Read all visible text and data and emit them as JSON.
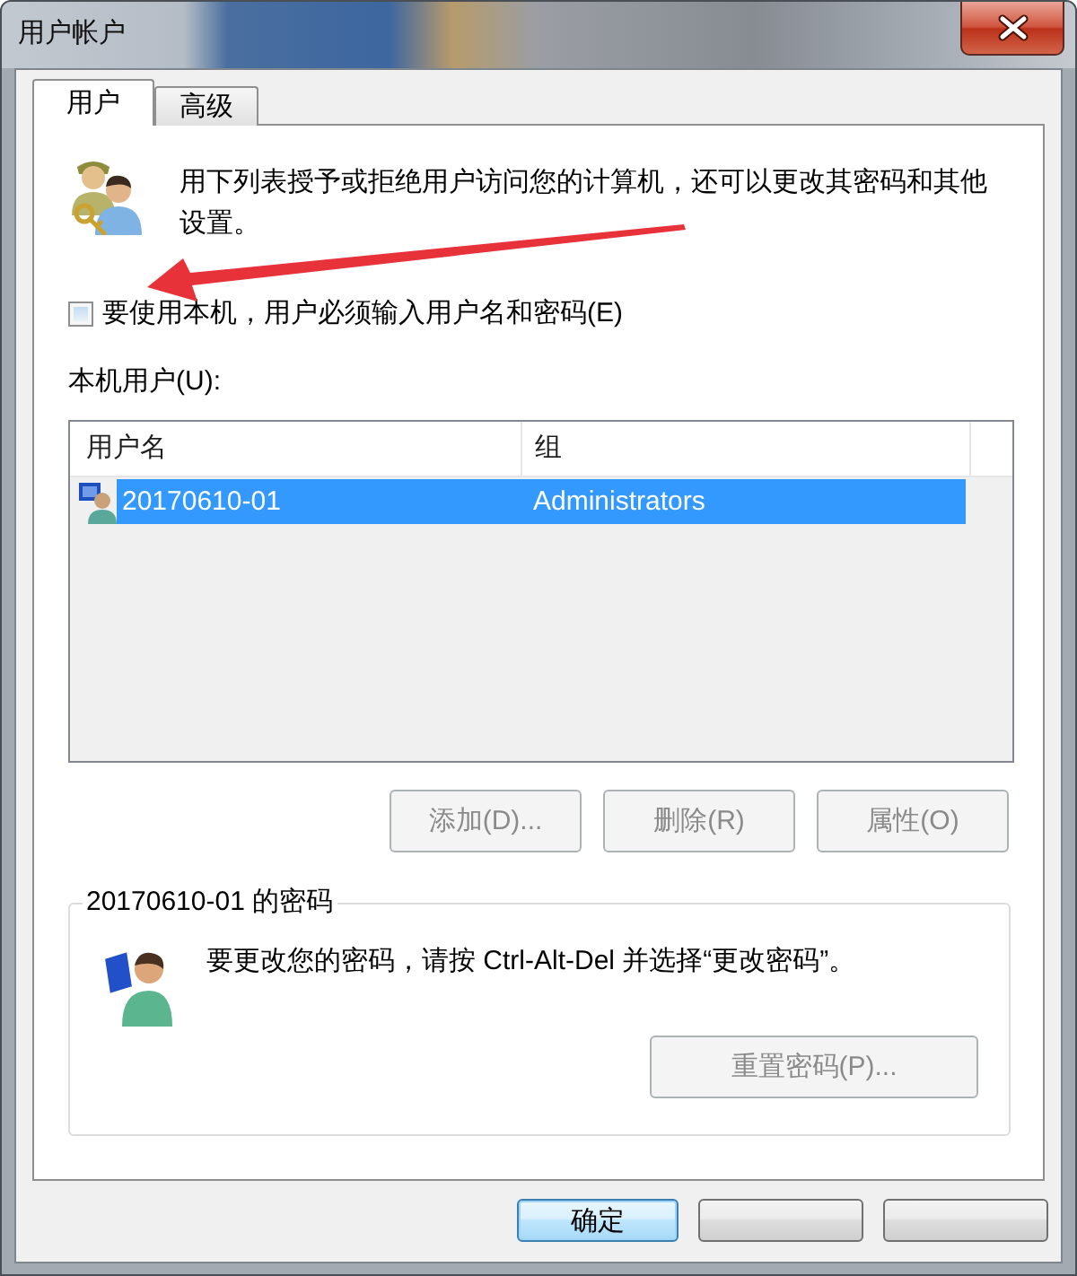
{
  "window": {
    "title": "用户帐户"
  },
  "tabs": [
    {
      "label": "用户",
      "selected": true
    },
    {
      "label": "高级",
      "selected": false
    }
  ],
  "intro": {
    "text": "用下列表授予或拒绝用户访问您的计算机，还可以更改其密码和其他设置。"
  },
  "checkbox": {
    "label": "要使用本机，用户必须输入用户名和密码(E)",
    "checked": false
  },
  "user_list": {
    "label": "本机用户(U):",
    "disabled": true,
    "columns": [
      "用户名",
      "组"
    ],
    "rows": [
      {
        "cells": [
          "20170610-01",
          "Administrators"
        ],
        "selected": true
      }
    ]
  },
  "list_buttons": [
    {
      "label": "添加(D)...",
      "disabled": true
    },
    {
      "label": "删除(R)",
      "disabled": true
    },
    {
      "label": "属性(O)",
      "disabled": true
    }
  ],
  "password_group": {
    "title": "20170610-01 的密码",
    "text": "要更改您的密码，请按 Ctrl-Alt-Del 并选择“更改密码”。",
    "button": {
      "label": "重置密码(P)...",
      "disabled": true
    }
  },
  "dialog_buttons": [
    {
      "label": "确定",
      "default": true
    },
    {
      "default": false
    },
    {
      "default": false
    }
  ]
}
